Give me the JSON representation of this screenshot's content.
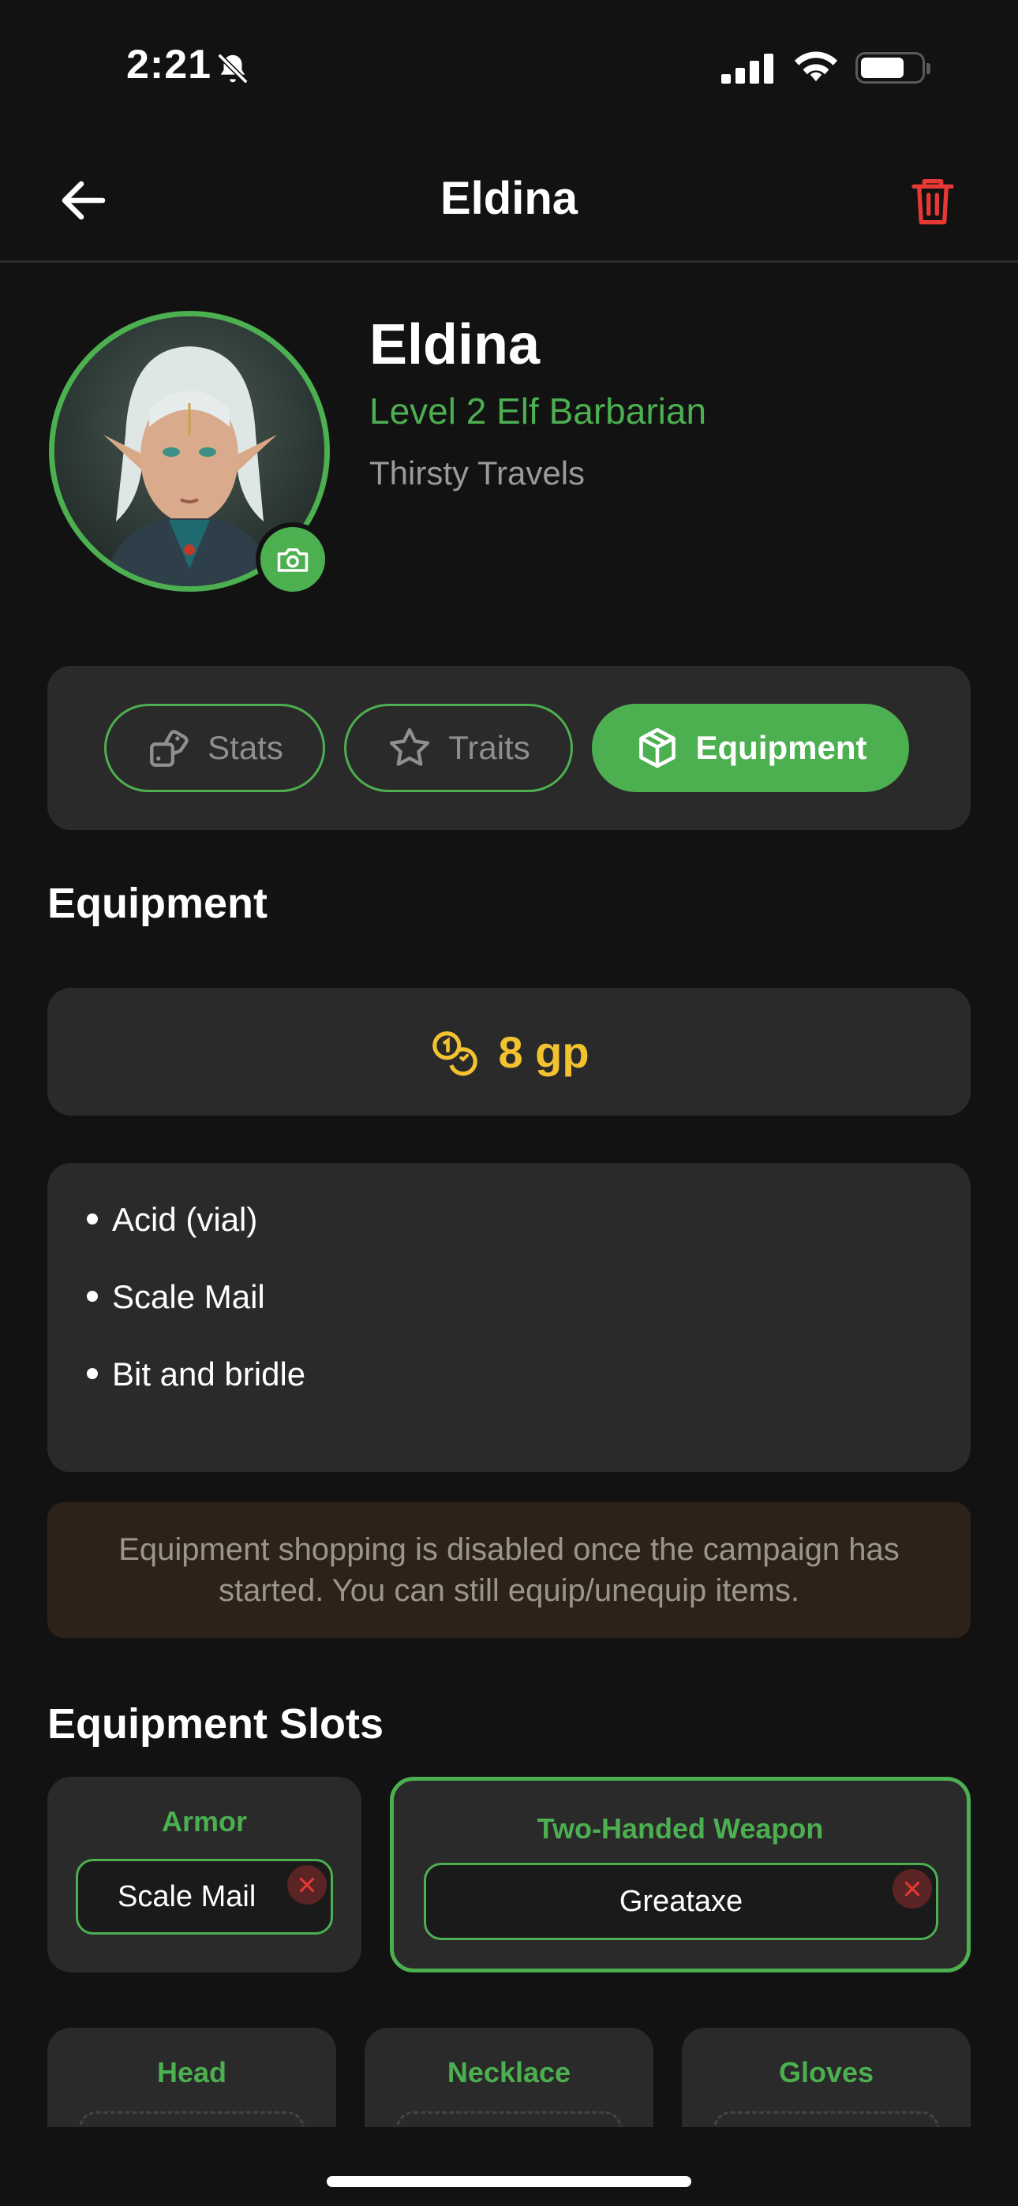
{
  "status_bar": {
    "time": "2:21"
  },
  "header": {
    "title": "Eldina"
  },
  "profile": {
    "name": "Eldina",
    "class_line": "Level 2 Elf Barbarian",
    "campaign": "Thirsty Travels"
  },
  "tabs": [
    {
      "label": "Stats",
      "icon": "dice-icon",
      "active": false
    },
    {
      "label": "Traits",
      "icon": "star-icon",
      "active": false
    },
    {
      "label": "Equipment",
      "icon": "box-icon",
      "active": true
    }
  ],
  "equipment": {
    "section_title": "Equipment",
    "gold": "8 gp",
    "items": [
      "Acid (vial)",
      "Scale Mail",
      "Bit and bridle"
    ],
    "notice": "Equipment shopping is disabled once the campaign has started. You can still equip/unequip items."
  },
  "slots": {
    "section_title": "Equipment Slots",
    "armor": {
      "label": "Armor",
      "value": "Scale Mail"
    },
    "weapon": {
      "label": "Two-Handed Weapon",
      "value": "Greataxe"
    },
    "head": {
      "label": "Head"
    },
    "necklace": {
      "label": "Necklace"
    },
    "gloves": {
      "label": "Gloves"
    }
  },
  "colors": {
    "accent": "#4caf50",
    "gold": "#f2c230",
    "danger": "#e53935",
    "card": "#2a2a2a",
    "background": "#121212"
  }
}
